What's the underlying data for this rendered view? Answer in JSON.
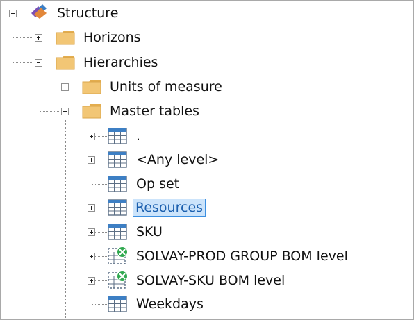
{
  "tree": {
    "root": {
      "label": "Structure",
      "icon": "structure-icon",
      "state": "expanded"
    },
    "nodes": [
      {
        "id": "horizons",
        "label": "Horizons",
        "icon": "folder-icon",
        "state": "collapsed"
      },
      {
        "id": "hierarchies",
        "label": "Hierarchies",
        "icon": "folder-icon",
        "state": "expanded"
      },
      {
        "id": "units",
        "label": "Units of measure",
        "icon": "folder-icon",
        "state": "collapsed"
      },
      {
        "id": "master",
        "label": "Master tables",
        "icon": "folder-icon",
        "state": "expanded"
      },
      {
        "id": "dot",
        "label": ".",
        "icon": "table-icon",
        "state": "collapsed"
      },
      {
        "id": "anylevel",
        "label": "<Any level>",
        "icon": "table-icon",
        "state": "collapsed"
      },
      {
        "id": "opset",
        "label": "Op set",
        "icon": "table-icon",
        "state": "leaf"
      },
      {
        "id": "resources",
        "label": "Resources",
        "icon": "table-icon",
        "state": "collapsed",
        "selected": true
      },
      {
        "id": "sku",
        "label": "SKU",
        "icon": "table-icon",
        "state": "collapsed"
      },
      {
        "id": "prodgroup",
        "label": "SOLVAY-PROD GROUP BOM level",
        "icon": "table-error-icon",
        "state": "collapsed"
      },
      {
        "id": "skubom",
        "label": "SOLVAY-SKU BOM level",
        "icon": "table-error-icon",
        "state": "collapsed"
      },
      {
        "id": "weekdays",
        "label": "Weekdays",
        "icon": "table-icon",
        "state": "leaf"
      }
    ]
  },
  "colors": {
    "folder": "#f2c675",
    "folder_tab": "#e3ad4e",
    "table_header": "#3d7fc4",
    "error_badge": "#2fa84f",
    "selection_bg": "#cce4fb",
    "selection_border": "#3c8fe0"
  }
}
